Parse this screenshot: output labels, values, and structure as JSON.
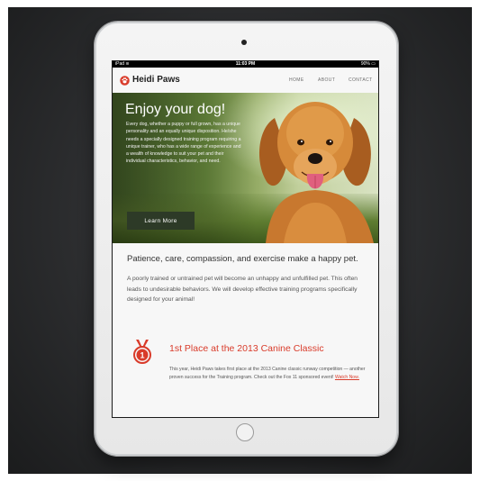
{
  "status_bar": {
    "device": "iPad",
    "wifi_icon": "wifi-icon",
    "time": "11:03 PM",
    "battery": "90%"
  },
  "site": {
    "logo_text": "Heidi Paws",
    "logo_icon": "paw-icon",
    "accent": "#d93b2a"
  },
  "nav": {
    "items": [
      {
        "label": "HOME"
      },
      {
        "label": "ABOUT"
      },
      {
        "label": "CONTACT"
      }
    ]
  },
  "hero": {
    "title": "Enjoy your dog!",
    "body": "Every dog, whether a puppy or full grown, has a unique personality and an equally unique disposition. He/she needs a specially designed training program requiring a unique trainer, who has a wide range of experience and a wealth of knowledge to suit your pet and their individual characteristics, behavior, and need.",
    "button_label": "Learn More"
  },
  "tagline": "Patience, care, compassion, and exercise make a happy pet.",
  "intro": "A poorly trained or untrained pet will become an unhappy and unfulfilled pet. This often leads to undesirable behaviors. We will develop effective training programs specifically designed for your animal!",
  "award": {
    "icon": "medal-icon",
    "medal_number": "1",
    "title": "1st Place at the 2013 Canine Classic",
    "body": "This year, Heidi Paws takes first place at the 2013 Canine classic runway competition — another proven success for the Training program. Check out the Fox 11 sponsored event!",
    "link_label": "Watch Now."
  }
}
